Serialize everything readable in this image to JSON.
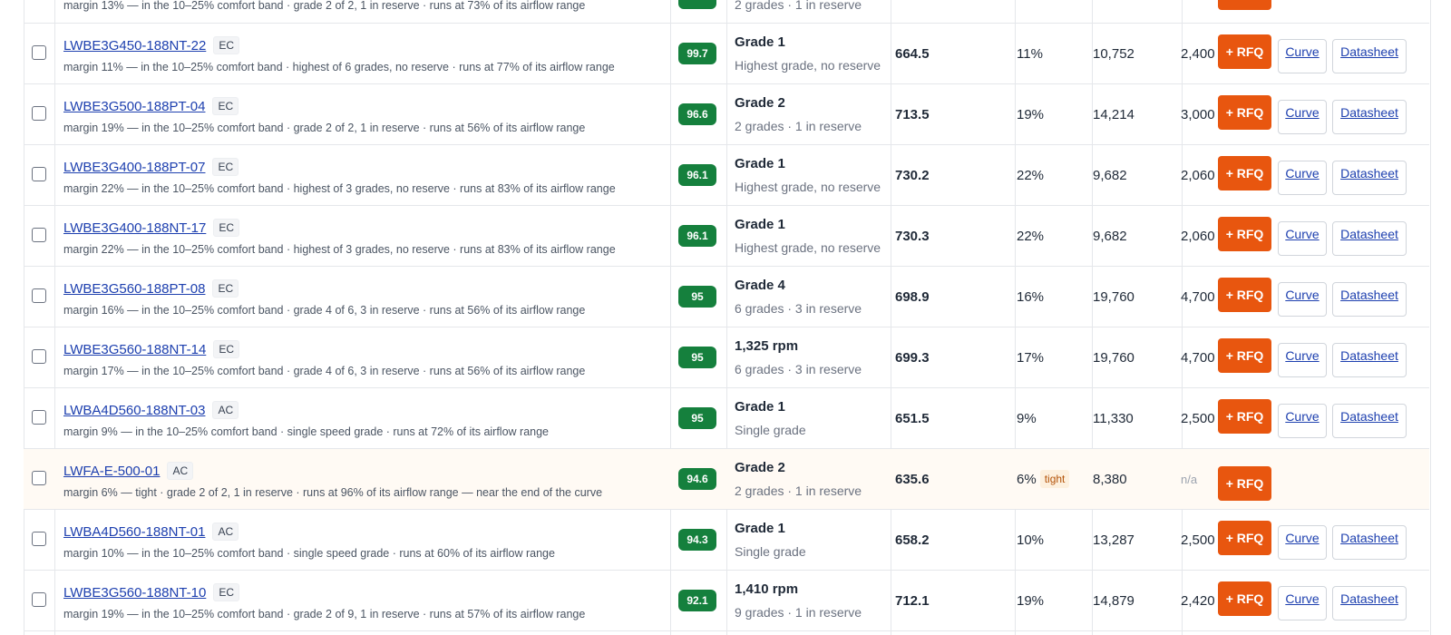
{
  "table": {
    "partial_top_row": {
      "margin_note": "margin 13% — in the 10–25% comfort band · grade 2 of 2, 1 in reserve · runs at 73% of its airflow range",
      "grade_sub": "2 grades · 1 in reserve"
    },
    "rows": [
      {
        "model": "LWBE3G450-188NT-22",
        "tag": "EC",
        "note": "margin 11% — in the 10–25% comfort band · highest of 6 grades, no reserve · runs at 77% of its airflow range",
        "score": "99.7",
        "grade": "Grade 1",
        "grade_sub": "Highest grade, no reserve",
        "pressure": "664.5",
        "margin": "11%",
        "tight": "",
        "airflow": "10,752",
        "power": "2,400",
        "power_na": false,
        "rfq": "+ RFQ",
        "curve": "Curve",
        "datasheet": "Datasheet"
      },
      {
        "model": "LWBE3G500-188PT-04",
        "tag": "EC",
        "note": "margin 19% — in the 10–25% comfort band · grade 2 of 2, 1 in reserve · runs at 56% of its airflow range",
        "score": "96.6",
        "grade": "Grade 2",
        "grade_sub": "2 grades · 1 in reserve",
        "pressure": "713.5",
        "margin": "19%",
        "tight": "",
        "airflow": "14,214",
        "power": "3,000",
        "power_na": false,
        "rfq": "+ RFQ",
        "curve": "Curve",
        "datasheet": "Datasheet"
      },
      {
        "model": "LWBE3G400-188PT-07",
        "tag": "EC",
        "note": "margin 22% — in the 10–25% comfort band · highest of 3 grades, no reserve · runs at 83% of its airflow range",
        "score": "96.1",
        "grade": "Grade 1",
        "grade_sub": "Highest grade, no reserve",
        "pressure": "730.2",
        "margin": "22%",
        "tight": "",
        "airflow": "9,682",
        "power": "2,060",
        "power_na": false,
        "rfq": "+ RFQ",
        "curve": "Curve",
        "datasheet": "Datasheet"
      },
      {
        "model": "LWBE3G400-188NT-17",
        "tag": "EC",
        "note": "margin 22% — in the 10–25% comfort band · highest of 3 grades, no reserve · runs at 83% of its airflow range",
        "score": "96.1",
        "grade": "Grade 1",
        "grade_sub": "Highest grade, no reserve",
        "pressure": "730.3",
        "margin": "22%",
        "tight": "",
        "airflow": "9,682",
        "power": "2,060",
        "power_na": false,
        "rfq": "+ RFQ",
        "curve": "Curve",
        "datasheet": "Datasheet"
      },
      {
        "model": "LWBE3G560-188PT-08",
        "tag": "EC",
        "note": "margin 16% — in the 10–25% comfort band · grade 4 of 6, 3 in reserve · runs at 56% of its airflow range",
        "score": "95",
        "grade": "Grade 4",
        "grade_sub": "6 grades · 3 in reserve",
        "pressure": "698.9",
        "margin": "16%",
        "tight": "",
        "airflow": "19,760",
        "power": "4,700",
        "power_na": false,
        "rfq": "+ RFQ",
        "curve": "Curve",
        "datasheet": "Datasheet"
      },
      {
        "model": "LWBE3G560-188NT-14",
        "tag": "EC",
        "note": "margin 17% — in the 10–25% comfort band · grade 4 of 6, 3 in reserve · runs at 56% of its airflow range",
        "score": "95",
        "grade": "1,325 rpm",
        "grade_sub": "6 grades · 3 in reserve",
        "pressure": "699.3",
        "margin": "17%",
        "tight": "",
        "airflow": "19,760",
        "power": "4,700",
        "power_na": false,
        "rfq": "+ RFQ",
        "curve": "Curve",
        "datasheet": "Datasheet"
      },
      {
        "model": "LWBA4D560-188NT-03",
        "tag": "AC",
        "note": "margin 9% — in the 10–25% comfort band · single speed grade · runs at 72% of its airflow range",
        "score": "95",
        "grade": "Grade 1",
        "grade_sub": "Single grade",
        "pressure": "651.5",
        "margin": "9%",
        "tight": "",
        "airflow": "11,330",
        "power": "2,500",
        "power_na": false,
        "rfq": "+ RFQ",
        "curve": "Curve",
        "datasheet": "Datasheet"
      },
      {
        "model": "LWFA-E-500-01",
        "tag": "AC",
        "note": "margin 6% — tight · grade 2 of 2, 1 in reserve · runs at 96% of its airflow range — near the end of the curve",
        "score": "94.6",
        "grade": "Grade 2",
        "grade_sub": "2 grades · 1 in reserve",
        "pressure": "635.6",
        "margin": "6%",
        "tight": "tight",
        "airflow": "8,380",
        "power": "n/a",
        "power_na": true,
        "rfq": "+ RFQ",
        "curve": "",
        "datasheet": ""
      },
      {
        "model": "LWBA4D560-188NT-01",
        "tag": "AC",
        "note": "margin 10% — in the 10–25% comfort band · single speed grade · runs at 60% of its airflow range",
        "score": "94.3",
        "grade": "Grade 1",
        "grade_sub": "Single grade",
        "pressure": "658.2",
        "margin": "10%",
        "tight": "",
        "airflow": "13,287",
        "power": "2,500",
        "power_na": false,
        "rfq": "+ RFQ",
        "curve": "Curve",
        "datasheet": "Datasheet"
      },
      {
        "model": "LWBE3G560-188NT-10",
        "tag": "EC",
        "note": "margin 19% — in the 10–25% comfort band · grade 2 of 9, 1 in reserve · runs at 57% of its airflow range",
        "score": "92.1",
        "grade": "1,410 rpm",
        "grade_sub": "9 grades · 1 in reserve",
        "pressure": "712.1",
        "margin": "19%",
        "tight": "",
        "airflow": "14,879",
        "power": "2,420",
        "power_na": false,
        "rfq": "+ RFQ",
        "curve": "Curve",
        "datasheet": "Datasheet"
      }
    ]
  },
  "colors": {
    "score_badge": "#15803d",
    "rfq_button": "#e8560f",
    "link": "#1e40af",
    "tight_badge_bg": "#fdf0de",
    "tight_badge_text": "#b45309"
  }
}
